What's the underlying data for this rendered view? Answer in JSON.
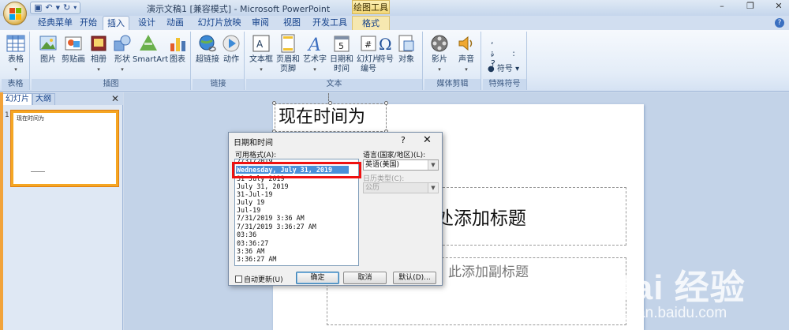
{
  "titlebar": {
    "doc_title": "演示文稿1 [兼容模式] - Microsoft PowerPoint",
    "context_tab_title": "绘图工具",
    "minimize": "–",
    "restore": "❐",
    "close": "✕"
  },
  "tabs": [
    {
      "label": "经典菜单"
    },
    {
      "label": "开始"
    },
    {
      "label": "插入"
    },
    {
      "label": "设计"
    },
    {
      "label": "动画"
    },
    {
      "label": "幻灯片放映"
    },
    {
      "label": "审阅"
    },
    {
      "label": "视图"
    },
    {
      "label": "开发工具"
    },
    {
      "label": "格式"
    }
  ],
  "ribbon": {
    "groups": {
      "table": "表格",
      "illustrations": "插图",
      "links": "链接",
      "text": "文本",
      "media": "媒体剪辑",
      "symbols": "特殊符号"
    },
    "buttons": {
      "table": "表格",
      "picture": "图片",
      "clipart": "剪贴画",
      "album": "相册",
      "shapes": "形状",
      "smartart": "SmartArt",
      "chart": "图表",
      "hyperlink": "超链接",
      "action": "动作",
      "textbox_1": "文本框",
      "header_1": "页眉和",
      "header_2": "页脚",
      "wordart": "艺术字",
      "datetime_1": "日期和",
      "datetime_2": "时间",
      "slidenum_1": "幻灯片",
      "slidenum_2": "编号",
      "symbol": "符号",
      "object": "对象",
      "movie": "影片",
      "sound": "声音",
      "symbol_small": "符号"
    }
  },
  "pane": {
    "tab_slides": "幻灯片",
    "tab_outline": "大纲",
    "close": "✕",
    "slide_number": "1",
    "thumb_text": "现在时间为"
  },
  "slide": {
    "textbox": "现在时间为",
    "title_placeholder": "处添加标题",
    "subtitle_placeholder": "此添加副标题"
  },
  "dialog": {
    "title": "日期和时间",
    "help": "?",
    "close": "✕",
    "formats_label": "可用格式(A):",
    "formats": [
      "7/31/2019",
      "Wednesday, July 31, 2019",
      "31 July 2019",
      "July 31, 2019",
      "31-Jul-19",
      "July 19",
      "Jul-19",
      "7/31/2019 3:36 AM",
      "7/31/2019 3:36:27 AM",
      "03:36",
      "03:36:27",
      "3:36 AM",
      "3:36:27 AM"
    ],
    "language_label": "语言(国家/地区)(L):",
    "language_value": "英语(美国)",
    "calendar_label": "日历类型(C):",
    "calendar_value": "公历",
    "auto_update": "自动更新(U)",
    "ok": "确定",
    "cancel": "取消",
    "default": "默认(D)..."
  },
  "watermark": {
    "brand": "Bai 经验",
    "url": "jingyan.baidu.com"
  }
}
